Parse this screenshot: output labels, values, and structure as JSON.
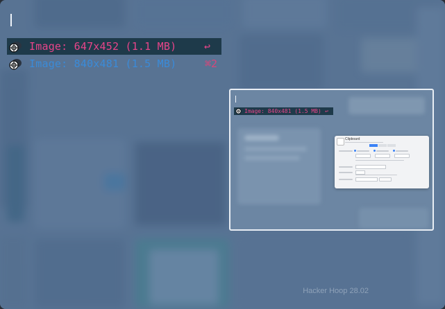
{
  "search": {
    "value": ""
  },
  "results": [
    {
      "label": "Image: 647x452 (1.1 MB)",
      "shortcut": "↩",
      "selected": true,
      "icon": "image-icon"
    },
    {
      "label": "Image: 840x481 (1.5 MB)",
      "shortcut": "⌘2",
      "selected": false,
      "icon": "image-icon"
    }
  ],
  "preview": {
    "mini_item": {
      "label": "Image: 840x481 (1.5 MB)",
      "shortcut": "↩"
    },
    "dialog": {
      "title": "Clipboard"
    }
  },
  "footer": {
    "text": "Hacker Hoop 28.02"
  },
  "colors": {
    "selected_text": "#e8458a",
    "secondary_text": "#3a8bd9",
    "selected_bg": "#1e3a4a",
    "panel_tint": "#5d7896"
  }
}
